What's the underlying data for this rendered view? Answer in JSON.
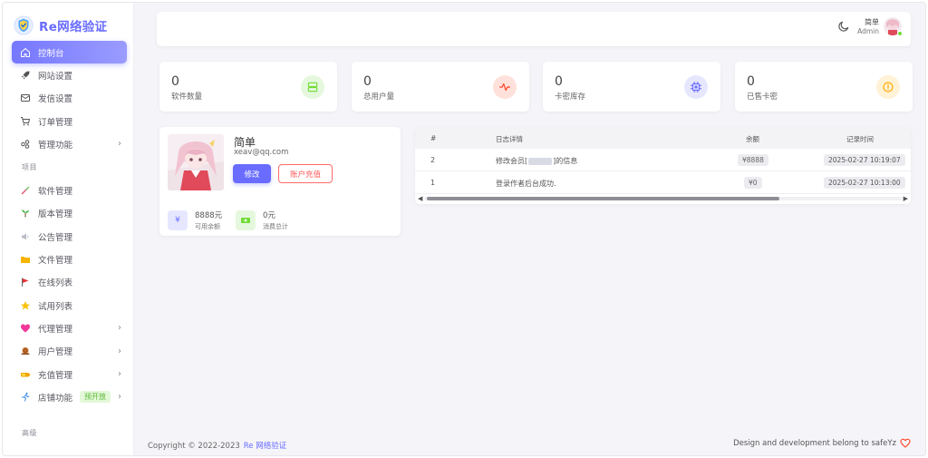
{
  "app": {
    "brand": "Re网络验证"
  },
  "colors": {
    "accent": "#696cff",
    "success": "#71dd37",
    "danger": "#ff3e1d",
    "warning": "#ffab00"
  },
  "sidebar": {
    "items": [
      {
        "label": "控制台",
        "icon": "home-icon",
        "active": true
      },
      {
        "label": "网站设置",
        "icon": "rocket-icon"
      },
      {
        "label": "发信设置",
        "icon": "mail-icon"
      },
      {
        "label": "订单管理",
        "icon": "cart-icon"
      },
      {
        "label": "管理功能",
        "icon": "widgets-icon",
        "has_children": true
      }
    ],
    "section_project": "项目",
    "project_items": [
      {
        "label": "软件管理",
        "icon": "syringe-icon"
      },
      {
        "label": "版本管理",
        "icon": "sprout-icon"
      },
      {
        "label": "公告管理",
        "icon": "speaker-icon"
      },
      {
        "label": "文件管理",
        "icon": "folder-icon"
      },
      {
        "label": "在线列表",
        "icon": "flag-icon"
      },
      {
        "label": "试用列表",
        "icon": "star-icon"
      },
      {
        "label": "代理管理",
        "icon": "heart-icon",
        "has_children": true
      },
      {
        "label": "用户管理",
        "icon": "snail-icon",
        "has_children": true
      },
      {
        "label": "充值管理",
        "icon": "battery-icon",
        "has_children": true
      },
      {
        "label": "店铺功能",
        "icon": "runner-icon",
        "has_children": true,
        "badge": "预开放"
      }
    ],
    "section_advanced": "高级"
  },
  "navbar": {
    "user_name": "简单",
    "user_role": "Admin"
  },
  "stats": [
    {
      "value": "0",
      "label": "软件数量",
      "icon": "server-icon",
      "color": "#71dd37"
    },
    {
      "value": "0",
      "label": "总用户量",
      "icon": "pulse-icon",
      "color": "#ff3e1d"
    },
    {
      "value": "0",
      "label": "卡密库存",
      "icon": "chip-icon",
      "color": "#696cff"
    },
    {
      "value": "0",
      "label": "已售卡密",
      "icon": "alert-circle-icon",
      "color": "#ffab00"
    }
  ],
  "profile": {
    "name": "简单",
    "email": "xeav@qq.com",
    "edit_label": "修改",
    "recharge_label": "账户充值",
    "balance_value": "8888元",
    "balance_label": "可用余额",
    "spent_value": "0元",
    "spent_label": "消费总计"
  },
  "logs": {
    "headers": [
      "#",
      "日志详情",
      "余额",
      "记录时间"
    ],
    "rows": [
      {
        "id": "2",
        "detail_prefix": "修改会员[",
        "detail_suffix": "]的信息",
        "balance": "¥8888",
        "time": "2025-02-27 10:19:07"
      },
      {
        "id": "1",
        "detail": "登录作者后台成功.",
        "balance": "¥0",
        "time": "2025-02-27 10:13:00"
      }
    ]
  },
  "footer": {
    "copyright": "Copyright © 2022-2023",
    "brand": "Re 网络验证",
    "credit": "Design and development belong to safeYz"
  }
}
